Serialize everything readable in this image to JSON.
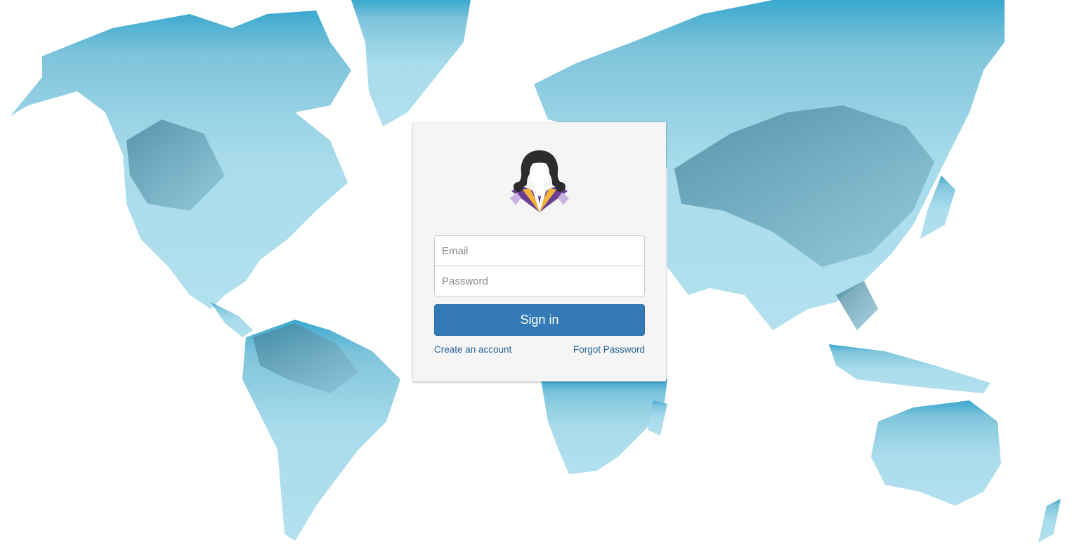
{
  "background": {
    "icon": "world-map-icon",
    "land_color": "#a8dcec",
    "mountain_color": "#5a93aa"
  },
  "login": {
    "avatar_icon": "user-avatar-icon",
    "email_placeholder": "Email",
    "email_value": "",
    "password_placeholder": "Password",
    "password_value": "",
    "signin_label": "Sign in",
    "create_account_label": "Create an account",
    "forgot_password_label": "Forgot Password",
    "accent_color": "#337ab7"
  }
}
